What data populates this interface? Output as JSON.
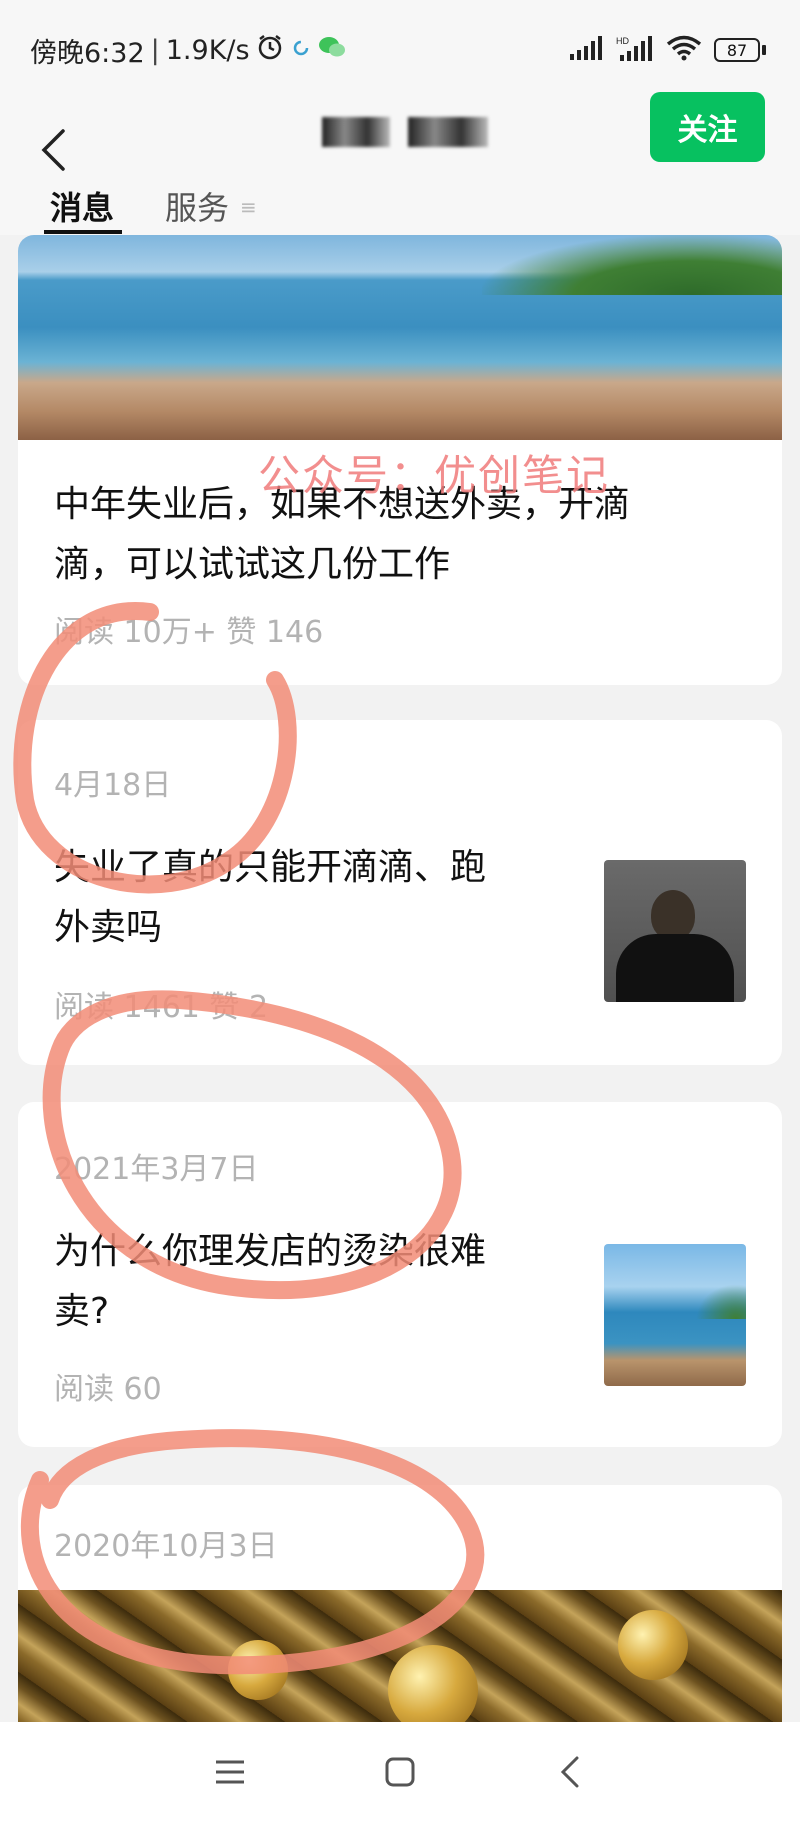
{
  "status_bar": {
    "time": "傍晚6:32",
    "network_speed": "1.9K/s",
    "battery": "87"
  },
  "header": {
    "follow_label": "关注"
  },
  "tabs": [
    {
      "label": "消息",
      "active": true
    },
    {
      "label": "服务"
    }
  ],
  "watermark": "公众号：优创笔记",
  "articles": [
    {
      "title_line1": "中年失业后，如果不想送外卖，开滴",
      "title_line2": "滴，可以试试这几份工作",
      "meta": "阅读 10万+  赞 146"
    },
    {
      "date": "4月18日",
      "title_line1": "失业了真的只能开滴滴、跑",
      "title_line2": "外卖吗",
      "meta": "阅读 1461  赞 2"
    },
    {
      "date": "2021年3月7日",
      "title_line1": "为什么你理发店的烫染很难",
      "title_line2": "卖?",
      "meta": "阅读 60"
    },
    {
      "date": "2020年10月3日"
    }
  ],
  "colors": {
    "accent": "#07c160",
    "annotation": "#f28c77",
    "watermark": "#f07b7b"
  }
}
